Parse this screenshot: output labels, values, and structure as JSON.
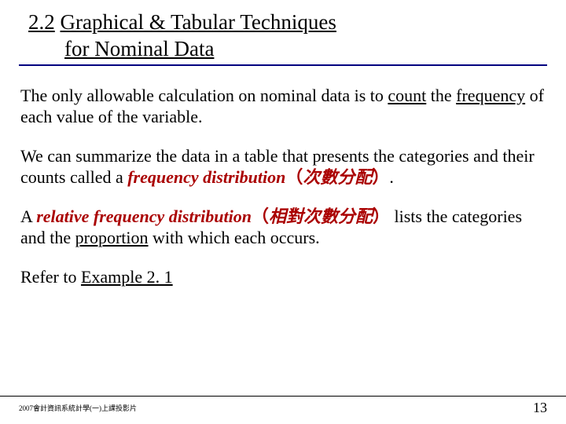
{
  "title": {
    "section_number": "2.2",
    "line1_rest": "Graphical & Tabular Techniques",
    "line2": "for Nominal Data"
  },
  "paragraphs": {
    "p1_a": "The only allowable calculation on nominal data is to ",
    "p1_count": "count",
    "p1_b": " the ",
    "p1_freq": "frequency",
    "p1_c": " of each value of the variable.",
    "p2_a": "We can summarize the data in a table that presents the categories and their counts called a ",
    "p2_term": "frequency distribution",
    "p2_paren_open": "（",
    "p2_zh": "次數分配",
    "p2_paren_close": "）",
    "p2_period": ".",
    "p3_a": "A ",
    "p3_term": "relative frequency distribution",
    "p3_paren_open": "（",
    "p3_zh": "相對次數分配",
    "p3_paren_close": "）",
    "p3_b": " lists the categories and the ",
    "p3_prop": "proportion",
    "p3_c": " with which each occurs.",
    "p4_a": "Refer to ",
    "p4_link": "Example 2. 1"
  },
  "footer": {
    "left": "2007會計資訊系統計學(一)上課投影片",
    "page": "13"
  }
}
